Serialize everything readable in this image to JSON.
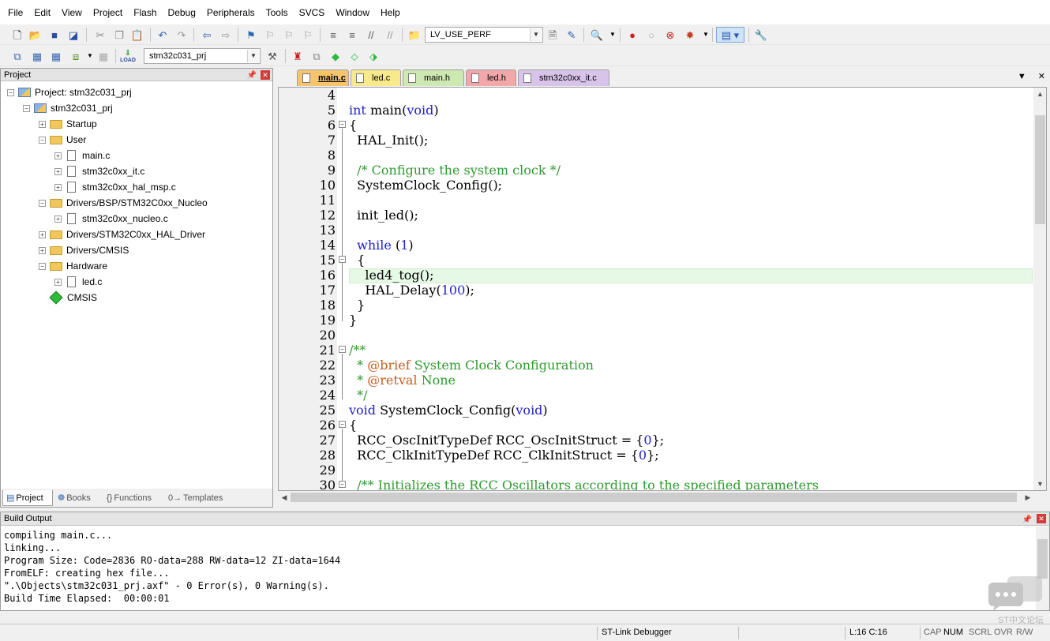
{
  "menu": [
    "File",
    "Edit",
    "View",
    "Project",
    "Flash",
    "Debug",
    "Peripherals",
    "Tools",
    "SVCS",
    "Window",
    "Help"
  ],
  "toolbar1": {
    "find_combo": "LV_USE_PERF"
  },
  "toolbar2": {
    "target_combo": "stm32c031_prj",
    "load_label": "LOAD"
  },
  "project_pane": {
    "title": "Project",
    "tree": [
      {
        "label": "Project: stm32c031_prj",
        "type": "project"
      },
      {
        "label": "stm32c031_prj",
        "type": "target"
      },
      {
        "label": "Startup",
        "type": "folder"
      },
      {
        "label": "User",
        "type": "folder"
      },
      {
        "label": "main.c",
        "type": "file"
      },
      {
        "label": "stm32c0xx_it.c",
        "type": "file"
      },
      {
        "label": "stm32c0xx_hal_msp.c",
        "type": "file"
      },
      {
        "label": "Drivers/BSP/STM32C0xx_Nucleo",
        "type": "folder"
      },
      {
        "label": "stm32c0xx_nucleo.c",
        "type": "file"
      },
      {
        "label": "Drivers/STM32C0xx_HAL_Driver",
        "type": "folder"
      },
      {
        "label": "Drivers/CMSIS",
        "type": "folder"
      },
      {
        "label": "Hardware",
        "type": "folder"
      },
      {
        "label": "led.c",
        "type": "file"
      },
      {
        "label": "CMSIS",
        "type": "component"
      }
    ],
    "tabs": [
      "Project",
      "Books",
      "Functions",
      "Templates"
    ]
  },
  "editor": {
    "tabs": [
      {
        "label": "main.c",
        "color": "#f5c46f"
      },
      {
        "label": "led.c",
        "color": "#f7e98c"
      },
      {
        "label": "main.h",
        "color": "#cde8b0"
      },
      {
        "label": "led.h",
        "color": "#f2a8a8"
      },
      {
        "label": "stm32c0xx_it.c",
        "color": "#d8c3ea"
      }
    ],
    "line_numbers": [
      "4",
      "5",
      "6",
      "7",
      "8",
      "9",
      "10",
      "11",
      "12",
      "13",
      "14",
      "15",
      "16",
      "17",
      "18",
      "19",
      "20",
      "21",
      "22",
      "23",
      "24",
      "25",
      "26",
      "27",
      "28",
      "29",
      "30"
    ]
  },
  "code": {
    "l5_kw1": "int",
    "l5_txt": " main(",
    "l5_kw2": "void",
    "l5_end": ")",
    "l6": "{",
    "l7": "  HAL_Init();",
    "l9": "  /* Configure the system clock */",
    "l10": "  SystemClock_Config();",
    "l12": "  init_led();",
    "l14_kw": "  while",
    "l14_a": " (",
    "l14_num": "1",
    "l14_b": ")",
    "l15": "  {",
    "l16": "    led4_tog();",
    "l17_a": "    HAL_Delay(",
    "l17_num": "100",
    "l17_b": ");",
    "l18": "  }",
    "l19": "}",
    "l21": "/**",
    "l22_a": "  * ",
    "l22_tag": "@brief",
    "l22_b": " System Clock Configuration",
    "l23_a": "  * ",
    "l23_tag": "@retval",
    "l23_b": " None",
    "l24": "  */",
    "l25_kw1": "void",
    "l25_txt": " SystemClock_Config(",
    "l25_kw2": "void",
    "l25_end": ")",
    "l26": "{",
    "l27_a": "  RCC_OscInitTypeDef RCC_OscInitStruct = {",
    "l27_num": "0",
    "l27_b": "};",
    "l28_a": "  RCC_ClkInitTypeDef RCC_ClkInitStruct = {",
    "l28_num": "0",
    "l28_b": "};",
    "l30": "  /** Initializes the RCC Oscillators according to the specified parameters"
  },
  "build_output": {
    "title": "Build Output",
    "lines": [
      "compiling main.c...",
      "linking...",
      "Program Size: Code=2836 RO-data=288 RW-data=12 ZI-data=1644",
      "FromELF: creating hex file...",
      "\".\\Objects\\stm32c031_prj.axf\" - 0 Error(s), 0 Warning(s).",
      "Build Time Elapsed:  00:00:01"
    ]
  },
  "status": {
    "debugger": "ST-Link Debugger",
    "position": "L:16 C:16",
    "caps": "CAP",
    "num": "NUM",
    "scrl": "SCRL",
    "ovr": "OVR",
    "rw": "R/W"
  },
  "watermark": "ST中文论坛"
}
